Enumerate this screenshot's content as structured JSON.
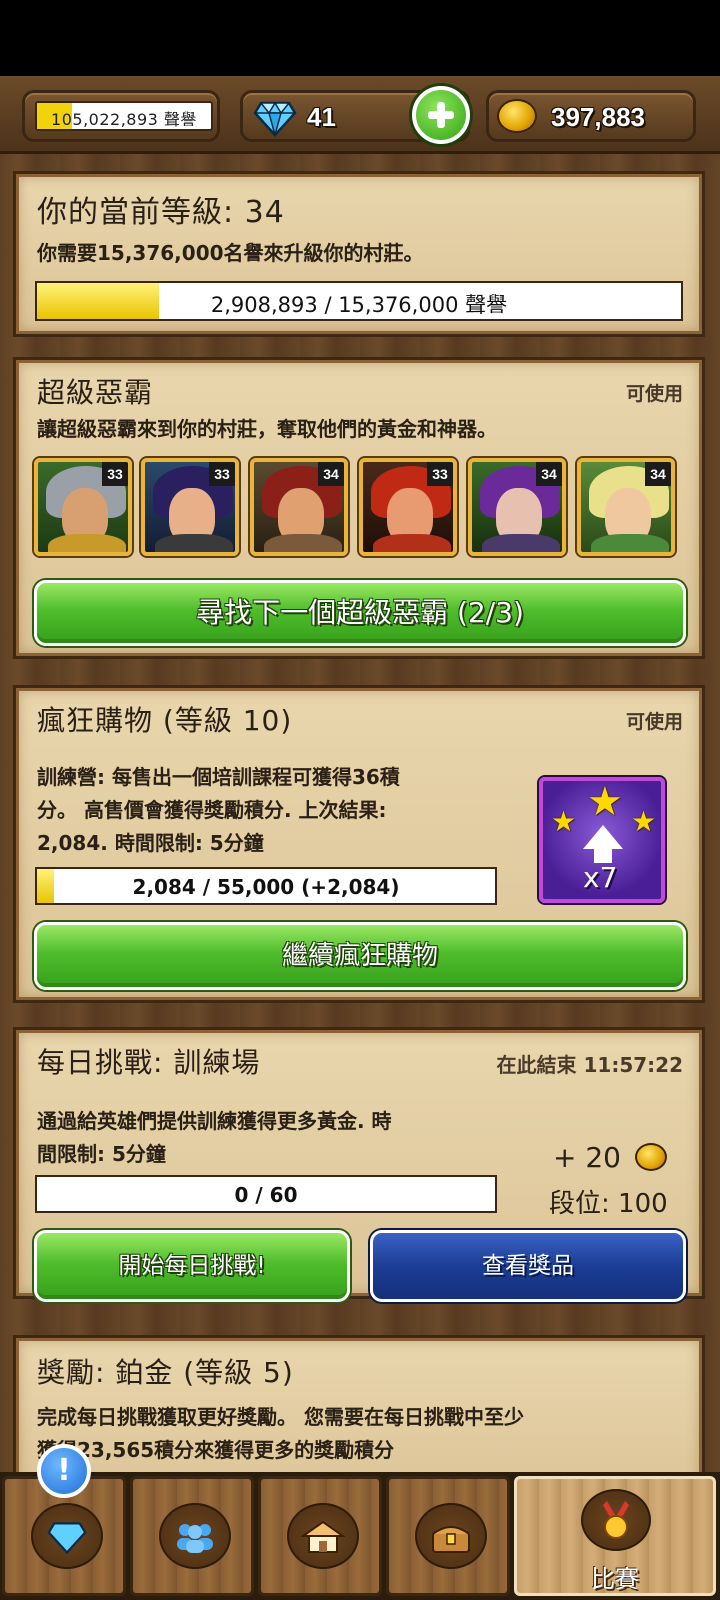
{
  "topbar": {
    "fame": "105,022,893 聲譽",
    "fame_progress": 0.2,
    "gems": "41",
    "gold": "397,883"
  },
  "level_panel": {
    "title": "你的當前等級: 34",
    "desc": "你需要15,376,000名譽來升級你的村莊。",
    "progress_text": "2,908,893 / 15,376,000 聲譽",
    "progress": 0.189
  },
  "super_villain": {
    "title": "超級惡霸",
    "tag": "可使用",
    "desc": "讓超級惡霸來到你的村莊，奪取他們的黃金和神器。",
    "heroes": [
      {
        "level": "33",
        "icon": "hero-portrait-icon"
      },
      {
        "level": "33",
        "icon": "hero-portrait-icon"
      },
      {
        "level": "34",
        "icon": "hero-portrait-icon"
      },
      {
        "level": "33",
        "icon": "hero-portrait-icon"
      },
      {
        "level": "34",
        "icon": "hero-portrait-icon"
      },
      {
        "level": "34",
        "icon": "hero-portrait-icon"
      }
    ],
    "button": "尋找下一個超級惡霸 (2/3)"
  },
  "shopping": {
    "title": "瘋狂購物 (等級 10)",
    "tag": "可使用",
    "desc_line1": "訓練營: 每售出一個培訓課程可獲得36積",
    "desc_line2": "分。 高售價會獲得獎勵積分. 上次結果:",
    "desc_line3": "2,084. 時間限制: 5分鐘",
    "progress_text": "2,084 / 55,000 (+2,084)",
    "progress": 0.038,
    "reward_multiplier": "x7",
    "button": "繼續瘋狂購物"
  },
  "daily": {
    "title": "每日挑戰: 訓練場",
    "ends": "在此結束 11:57:22",
    "desc_line1": "通過給英雄們提供訓練獲得更多黃金. 時",
    "desc_line2": "間限制: 5分鐘",
    "reward": "+ 20",
    "rank": "段位: 100",
    "progress_text": "0 / 60",
    "progress": 0,
    "start_button": "開始每日挑戰!",
    "prize_button": "查看獎品"
  },
  "reward_panel": {
    "title": "獎勵: 鉑金 (等級 5)",
    "desc_line1": "完成每日挑戰獲取更好獎勵。 您需要在每日挑戰中至少",
    "desc_line2": "獲得23,565積分來獲得更多的獎勵積分"
  },
  "nav": {
    "notify": "!",
    "active_label": "比賽",
    "tabs": [
      "gem-icon",
      "team-icon",
      "village-icon",
      "treasure-chest-icon",
      "medal-icon"
    ]
  }
}
